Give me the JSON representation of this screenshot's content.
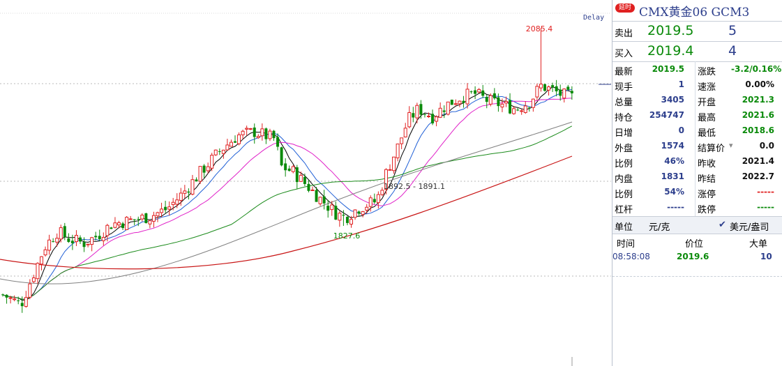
{
  "chart": {
    "delay_label": "Delay",
    "annotations": {
      "high": "2085.4",
      "low": "1827.6",
      "gap": "1892.5 - 1891.1"
    },
    "colors": {
      "up": "#e02020",
      "down": "#0a8a0a",
      "ma5": "#000000",
      "ma10": "#1f5fd6",
      "ma20": "#e020c8",
      "ma60": "#1a8a1a",
      "ma120": "#808080",
      "ma250": "#c81414"
    }
  },
  "panel": {
    "badge": "延时",
    "title": "CMX黄金06  GCM3",
    "ask": {
      "label": "卖出",
      "price": "2019.5",
      "volume": "5"
    },
    "bid": {
      "label": "买入",
      "price": "2019.4",
      "volume": "4"
    },
    "rows": [
      {
        "l": "最新",
        "lv": "2019.5",
        "lc": "green",
        "r": "涨跌",
        "rv": "-3.2/0.16%",
        "rc": "green"
      },
      {
        "l": "现手",
        "lv": "1",
        "lc": "blue",
        "r": "速涨",
        "rv": "0.00%",
        "rc": "dark"
      },
      {
        "l": "总量",
        "lv": "3405",
        "lc": "blue",
        "r": "开盘",
        "rv": "2021.3",
        "rc": "green"
      },
      {
        "l": "持仓",
        "lv": "254747",
        "lc": "blue",
        "r": "最高",
        "rv": "2021.6",
        "rc": "green"
      },
      {
        "l": "日增",
        "lv": "0",
        "lc": "blue",
        "r": "最低",
        "rv": "2018.6",
        "rc": "green"
      },
      {
        "l": "外盘",
        "lv": "1574",
        "lc": "blue",
        "r": "结算价",
        "rv": "0.0",
        "rc": "dark"
      },
      {
        "l": "比例",
        "lv": "46%",
        "lc": "blue",
        "r": "昨收",
        "rv": "2021.4",
        "rc": "dark"
      },
      {
        "l": "内盘",
        "lv": "1831",
        "lc": "blue",
        "r": "昨结",
        "rv": "2022.7",
        "rc": "dark"
      },
      {
        "l": "比例",
        "lv": "54%",
        "lc": "blue",
        "r": "涨停",
        "rv": "-----",
        "rc": "red"
      },
      {
        "l": "杠杆",
        "lv": "-----",
        "lc": "blue",
        "r": "跌停",
        "rv": "-----",
        "rc": "green"
      }
    ],
    "unit": {
      "label": "单位",
      "value": "元/克",
      "alt": "美元/盎司"
    },
    "trades": {
      "headers": {
        "time": "时间",
        "price": "价位",
        "size": "大单"
      },
      "rows": [
        {
          "time": "08:58:08",
          "price": "2019.6",
          "size": "10"
        }
      ]
    }
  }
}
